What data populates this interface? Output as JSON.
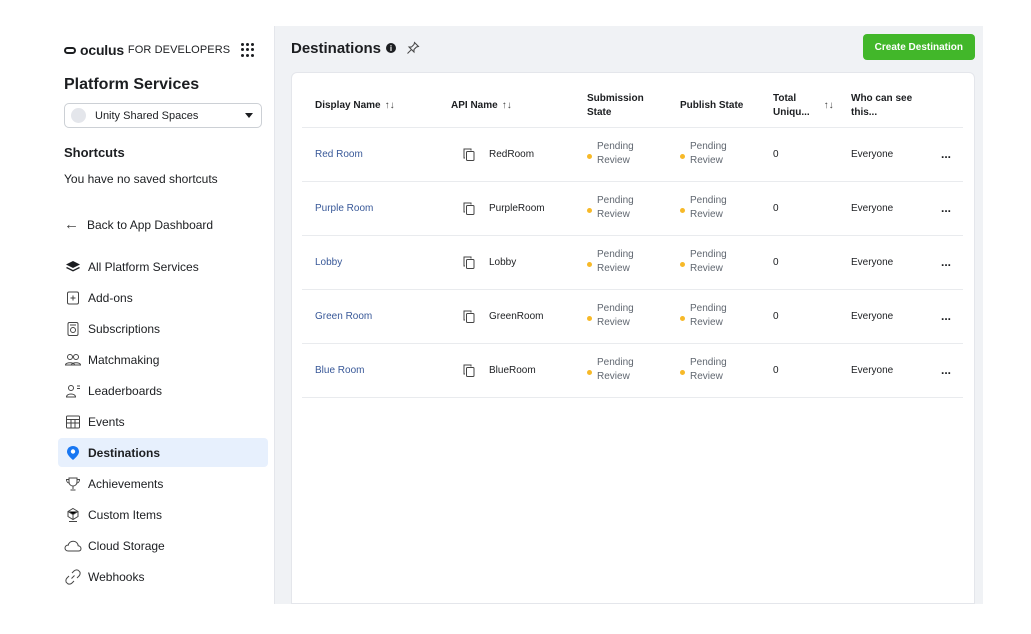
{
  "brand": {
    "name": "oculus",
    "sub": "FOR DEVELOPERS"
  },
  "sidebar": {
    "section_title": "Platform Services",
    "app_select": "Unity Shared Spaces",
    "shortcuts_title": "Shortcuts",
    "shortcuts_empty": "You have no saved shortcuts",
    "back_link": "Back to App Dashboard",
    "items": [
      {
        "label": "All Platform Services",
        "icon": "layers-icon"
      },
      {
        "label": "Add-ons",
        "icon": "add-on-icon"
      },
      {
        "label": "Subscriptions",
        "icon": "subscription-icon"
      },
      {
        "label": "Matchmaking",
        "icon": "people-icon"
      },
      {
        "label": "Leaderboards",
        "icon": "leaderboard-icon"
      },
      {
        "label": "Events",
        "icon": "calendar-icon"
      },
      {
        "label": "Destinations",
        "icon": "location-pin-icon"
      },
      {
        "label": "Achievements",
        "icon": "trophy-icon"
      },
      {
        "label": "Custom Items",
        "icon": "custom-item-icon"
      },
      {
        "label": "Cloud Storage",
        "icon": "cloud-icon"
      },
      {
        "label": "Webhooks",
        "icon": "link-icon"
      }
    ],
    "active_item": "Destinations"
  },
  "header": {
    "title": "Destinations",
    "create_button": "Create Destination"
  },
  "table": {
    "columns": {
      "display_name": "Display Name",
      "api_name": "API Name",
      "submission_state": [
        "Submission",
        "State"
      ],
      "publish_state": "Publish State",
      "total": [
        "Total",
        "Uniqu..."
      ],
      "who": [
        "Who can see",
        "this..."
      ]
    },
    "rows": [
      {
        "display_name": "Red Room",
        "api_name": "RedRoom",
        "submission": [
          "Pending",
          "Review"
        ],
        "publish": [
          "Pending",
          "Review"
        ],
        "total": "0",
        "who": "Everyone",
        "more": "..."
      },
      {
        "display_name": "Purple Room",
        "api_name": "PurpleRoom",
        "submission": [
          "Pending",
          "Review"
        ],
        "publish": [
          "Pending",
          "Review"
        ],
        "total": "0",
        "who": "Everyone",
        "more": "..."
      },
      {
        "display_name": "Lobby",
        "api_name": "Lobby",
        "submission": [
          "Pending",
          "Review"
        ],
        "publish": [
          "Pending",
          "Review"
        ],
        "total": "0",
        "who": "Everyone",
        "more": "..."
      },
      {
        "display_name": "Green Room",
        "api_name": "GreenRoom",
        "submission": [
          "Pending",
          "Review"
        ],
        "publish": [
          "Pending",
          "Review"
        ],
        "total": "0",
        "who": "Everyone",
        "more": "..."
      },
      {
        "display_name": "Blue Room",
        "api_name": "BlueRoom",
        "submission": [
          "Pending",
          "Review"
        ],
        "publish": [
          "Pending",
          "Review"
        ],
        "total": "0",
        "who": "Everyone",
        "more": "..."
      }
    ]
  },
  "colors": {
    "accent_green": "#42b72a",
    "link_blue": "#385898",
    "pending_yellow": "#f7b928",
    "active_bg": "#e7f0fd",
    "active_icon": "#1877f2"
  }
}
